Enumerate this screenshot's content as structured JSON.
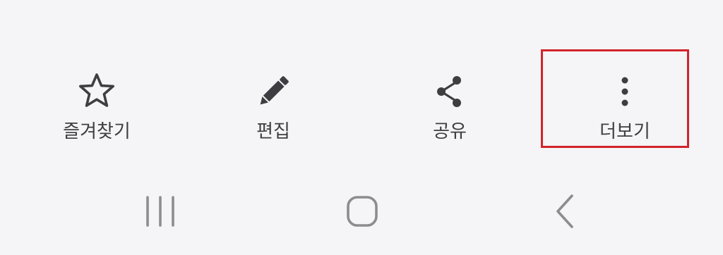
{
  "toolbar": {
    "items": [
      {
        "label": "즐겨찾기",
        "icon": "star-outline-icon"
      },
      {
        "label": "편집",
        "icon": "pencil-icon"
      },
      {
        "label": "공유",
        "icon": "share-icon"
      },
      {
        "label": "더보기",
        "icon": "more-vertical-icon"
      }
    ]
  },
  "navbar": {
    "buttons": [
      {
        "icon": "recent-apps-icon"
      },
      {
        "icon": "home-icon"
      },
      {
        "icon": "back-icon"
      }
    ]
  },
  "colors": {
    "background": "#f5f4f7",
    "icon": "#3e3e42",
    "navbar_icon": "#8d8d90",
    "highlight": "#d2232a"
  }
}
